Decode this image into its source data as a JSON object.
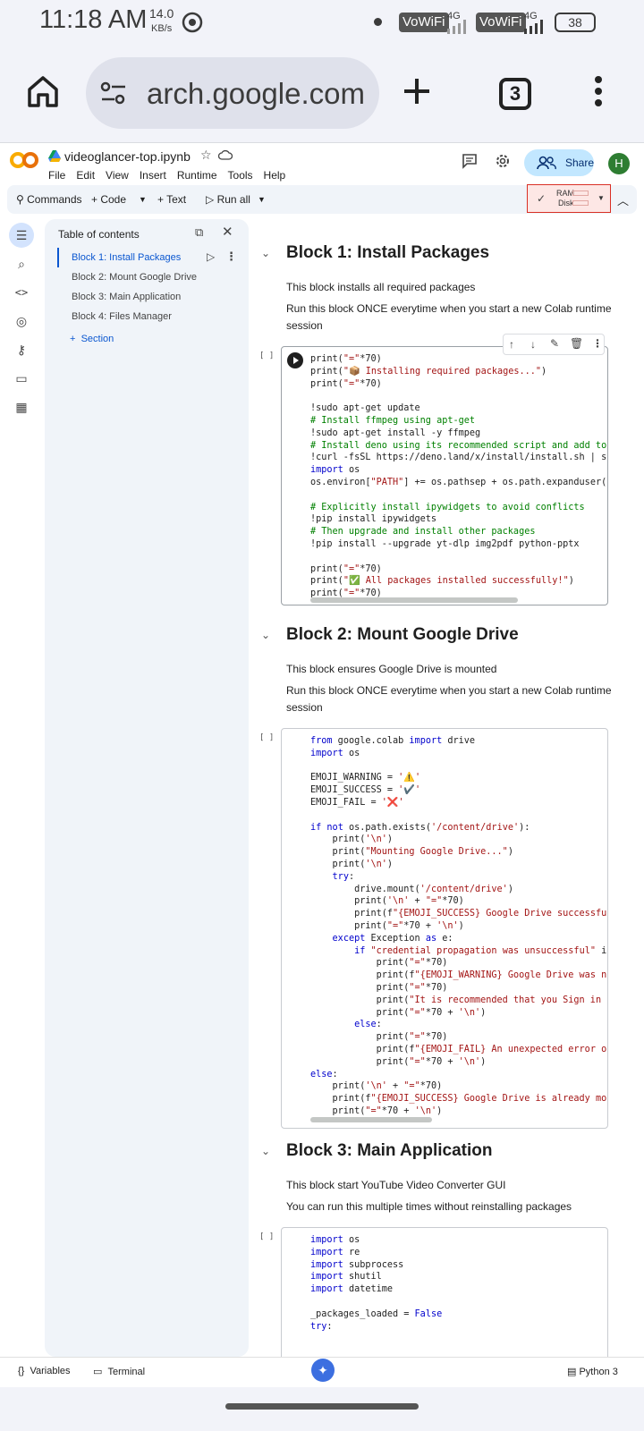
{
  "status": {
    "time": "11:18 AM",
    "speed_value": "14.0",
    "speed_unit": "KB/s",
    "vowifi_1": "VoWiFi",
    "vowifi_2": "VoWiFi",
    "net_1": "4G",
    "net_2": "4G",
    "battery": "38"
  },
  "browser": {
    "url": "arch.google.com",
    "tab_count": "3"
  },
  "colab": {
    "doc_name": "videoglancer-top.ipynb",
    "menus": [
      "File",
      "Edit",
      "View",
      "Insert",
      "Runtime",
      "Tools",
      "Help"
    ],
    "share_label": "Share",
    "avatar_letter": "H"
  },
  "toolbar": {
    "commands": "Commands",
    "code": "+ Code",
    "text": "+ Text",
    "run_all": "Run all",
    "ram": "RAM",
    "disk": "Disk"
  },
  "toc": {
    "title": "Table of contents",
    "items": [
      "Block 1: Install Packages",
      "Block 2: Mount Google Drive",
      "Block 3: Main Application",
      "Block 4: Files Manager"
    ],
    "section_label": "Section"
  },
  "blocks": {
    "b1_title": "Block 1: Install Packages",
    "b1_p1": "This block installs all required packages",
    "b1_p2": "Run this block ONCE everytime when you start a new Colab runtime session",
    "b2_title": "Block 2: Mount Google Drive",
    "b2_p1": "This block ensures Google Drive is mounted",
    "b2_p2": "Run this block ONCE everytime when you start a new Colab runtime session",
    "b3_title": "Block 3: Main Application",
    "b3_p1": "This block start YouTube Video Converter GUI",
    "b3_p2": "You can run this multiple times without reinstalling packages",
    "cell_bracket": "[ ]"
  },
  "code1": [
    "print(\"=\"*70)",
    "print(\"📦 Installing required packages...\")",
    "print(\"=\"*70)",
    "",
    "!sudo apt-get update",
    "# Install ffmpeg using apt-get",
    "!sudo apt-get install -y ffmpeg",
    "# Install deno using its recommended script and add to",
    "!curl -fsSL https://deno.land/x/install/install.sh | s",
    "import os",
    "os.environ[\"PATH\"] += os.pathsep + os.path.expanduser(",
    "",
    "# Explicitly install ipywidgets to avoid conflicts",
    "!pip install ipywidgets",
    "# Then upgrade and install other packages",
    "!pip install --upgrade yt-dlp img2pdf python-pptx",
    "",
    "print(\"=\"*70)",
    "print(\"✅ All packages installed successfully!\")",
    "print(\"=\"*70)"
  ],
  "code2": [
    "from google.colab import drive",
    "import os",
    "",
    "EMOJI_WARNING = '⚠️'",
    "EMOJI_SUCCESS = '✔️'",
    "EMOJI_FAIL = '❌'",
    "",
    "if not os.path.exists('/content/drive'):",
    "    print('\\n')",
    "    print(\"Mounting Google Drive...\")",
    "    print('\\n')",
    "    try:",
    "        drive.mount('/content/drive')",
    "        print('\\n' + \"=\"*70)",
    "        print(f\"{EMOJI_SUCCESS} Google Drive successfu",
    "        print(\"=\"*70 + '\\n')",
    "    except Exception as e:",
    "        if \"credential propagation was unsuccessful\" i",
    "            print(\"=\"*70)",
    "            print(f\"{EMOJI_WARNING} Google Drive was n",
    "            print(\"=\"*70)",
    "            print(\"It is recommended that you Sign in ",
    "            print(\"=\"*70 + '\\n')",
    "        else:",
    "            print(\"=\"*70)",
    "            print(f\"{EMOJI_FAIL} An unexpected error o",
    "            print(\"=\"*70 + '\\n')",
    "else:",
    "    print('\\n' + \"=\"*70)",
    "    print(f\"{EMOJI_SUCCESS} Google Drive is already mo",
    "    print(\"=\"*70 + '\\n')"
  ],
  "code3": [
    "import os",
    "import re",
    "import subprocess",
    "import shutil",
    "import datetime",
    "",
    "_packages_loaded = False",
    "try:"
  ],
  "bottom": {
    "variables": "Variables",
    "terminal": "Terminal",
    "runtime": "Python 3"
  }
}
